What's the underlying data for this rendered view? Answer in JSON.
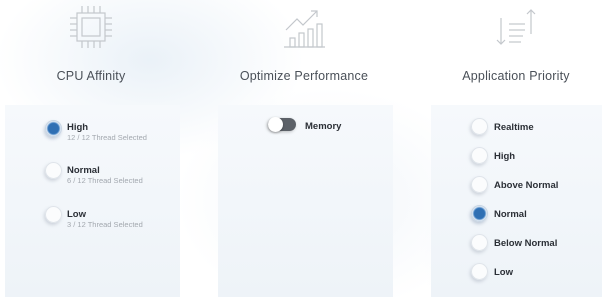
{
  "columns": {
    "cpu_affinity": {
      "title": "CPU Affinity",
      "icon": "cpu-chip-icon",
      "options": [
        {
          "label": "High",
          "sub": "12 / 12 Thread Selected",
          "selected": true
        },
        {
          "label": "Normal",
          "sub": "6 / 12 Thread Selected",
          "selected": false
        },
        {
          "label": "Low",
          "sub": "3 / 12 Thread Selected",
          "selected": false
        }
      ]
    },
    "optimize_performance": {
      "title": "Optimize Performance",
      "icon": "performance-chart-icon",
      "toggle": {
        "label": "Memory",
        "on": false
      }
    },
    "application_priority": {
      "title": "Application Priority",
      "icon": "sort-priority-icon",
      "options": [
        {
          "label": "Realtime",
          "selected": false
        },
        {
          "label": "High",
          "selected": false
        },
        {
          "label": "Above Normal",
          "selected": false
        },
        {
          "label": "Normal",
          "selected": true
        },
        {
          "label": "Below Normal",
          "selected": false
        },
        {
          "label": "Low",
          "selected": false
        }
      ]
    }
  },
  "colors": {
    "accent": "#2f6fb3",
    "icon_stroke": "#c3c7cc",
    "panel_bg": "#f3f7fb",
    "toggle_off": "#5c6168"
  }
}
